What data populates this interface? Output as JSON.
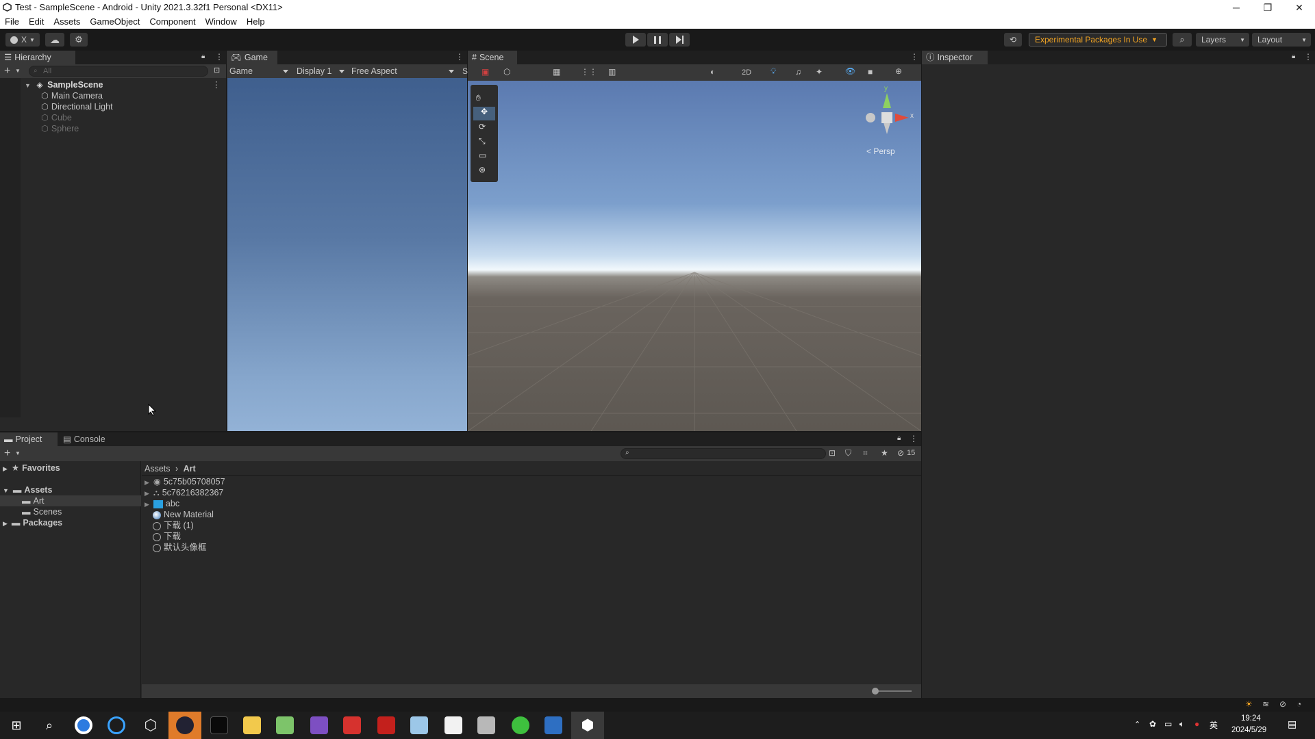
{
  "window": {
    "title": "Test - SampleScene - Android - Unity 2021.3.32f1 Personal <DX11>",
    "minimize": "─",
    "maximize": "❐",
    "close": "✕"
  },
  "menu": [
    "File",
    "Edit",
    "Assets",
    "GameObject",
    "Component",
    "Window",
    "Help"
  ],
  "toolbar": {
    "account": "X",
    "experimental": "Experimental Packages In Use",
    "layers": "Layers",
    "layout": "Layout"
  },
  "hierarchy": {
    "tab": "Hierarchy",
    "search_placeholder": "All",
    "scene": "SampleScene",
    "items": [
      {
        "label": "Main Camera",
        "active": true
      },
      {
        "label": "Directional Light",
        "active": true
      },
      {
        "label": "Cube",
        "active": false
      },
      {
        "label": "Sphere",
        "active": false
      }
    ]
  },
  "game": {
    "tab": "Game",
    "mode": "Game",
    "display": "Display 1",
    "aspect": "Free Aspect",
    "scale": "S"
  },
  "scene": {
    "tab": "Scene",
    "toggle_2d": "2D",
    "persp": "< Persp",
    "axis_y": "y",
    "axis_x": "x"
  },
  "inspector": {
    "tab": "Inspector"
  },
  "project": {
    "tab_project": "Project",
    "tab_console": "Console",
    "hidden_count": "15",
    "favorites": "Favorites",
    "assets": "Assets",
    "folders": [
      "Art",
      "Scenes"
    ],
    "packages": "Packages",
    "breadcrumb": [
      "Assets",
      "Art"
    ],
    "files": [
      {
        "name": "5c75b05708057",
        "type": "model"
      },
      {
        "name": "5c76216382367",
        "type": "prefab"
      },
      {
        "name": "abc",
        "type": "image"
      },
      {
        "name": "New Material",
        "type": "material"
      },
      {
        "name": "下载 (1)",
        "type": "texture"
      },
      {
        "name": "下载",
        "type": "texture"
      },
      {
        "name": "默认头像框",
        "type": "texture"
      }
    ]
  },
  "taskbar": {
    "time": "19:24",
    "date": "2024/5/29",
    "ime": "英"
  },
  "colors": {
    "accent": "#3a79bb",
    "warning": "#f5a623",
    "editor_bg": "#282828",
    "panel_bg": "#383838"
  }
}
